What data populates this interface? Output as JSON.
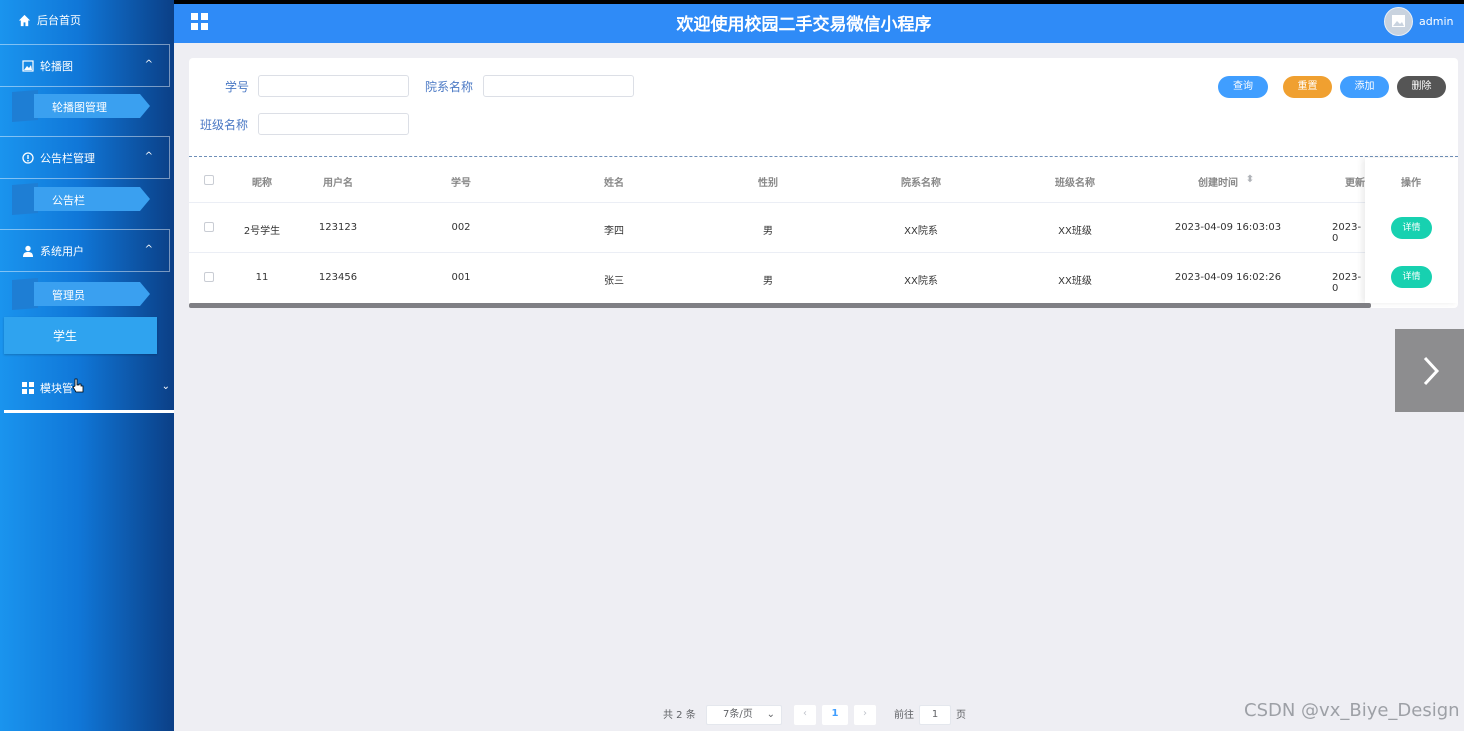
{
  "sidebar": {
    "home": "后台首页",
    "groups": [
      {
        "label": "轮播图",
        "item": "轮播图管理",
        "icon": "image-icon"
      },
      {
        "label": "公告栏管理",
        "item": "公告栏",
        "icon": "info-icon"
      },
      {
        "label": "系统用户",
        "item": "管理员",
        "icon": "user-icon"
      }
    ],
    "active_item": "学生",
    "module": "模块管",
    "chevron_up": "^",
    "chevron_down": "⌄"
  },
  "header": {
    "title": "欢迎使用校园二手交易微信小程序",
    "user": "admin"
  },
  "search": {
    "student_no_label": "学号",
    "dept_label": "院系名称",
    "class_label": "班级名称",
    "buttons": {
      "query": "查询",
      "reset": "重置",
      "add": "添加",
      "delete": "删除"
    }
  },
  "colors": {
    "query": "#409eff",
    "reset": "#f0a030",
    "add": "#409eff",
    "delete": "#555555",
    "detail": "#17d1b0"
  },
  "table": {
    "headers": [
      "昵称",
      "用户名",
      "学号",
      "姓名",
      "性别",
      "院系名称",
      "班级名称",
      "创建时间",
      "更新",
      "操作"
    ],
    "sort_icon": "⬍",
    "rows": [
      {
        "nickname": "2号学生",
        "username": "123123",
        "student_no": "002",
        "name": "李四",
        "gender": "男",
        "dept": "XX院系",
        "class": "XX班级",
        "created": "2023-04-09 16:03:03",
        "updated": "2023-0",
        "action": "详情"
      },
      {
        "nickname": "11",
        "username": "123456",
        "student_no": "001",
        "name": "张三",
        "gender": "男",
        "dept": "XX院系",
        "class": "XX班级",
        "created": "2023-04-09 16:02:26",
        "updated": "2023-0",
        "action": "详情"
      }
    ]
  },
  "pagination": {
    "total": "共 2 条",
    "page_size": "7条/页",
    "current_page": "1",
    "goto_label": "前往",
    "goto_value": "1",
    "page_suffix": "页",
    "prev": "‹",
    "next": "›",
    "size_caret": "⌄"
  },
  "watermark": "CSDN @vx_Biye_Design"
}
